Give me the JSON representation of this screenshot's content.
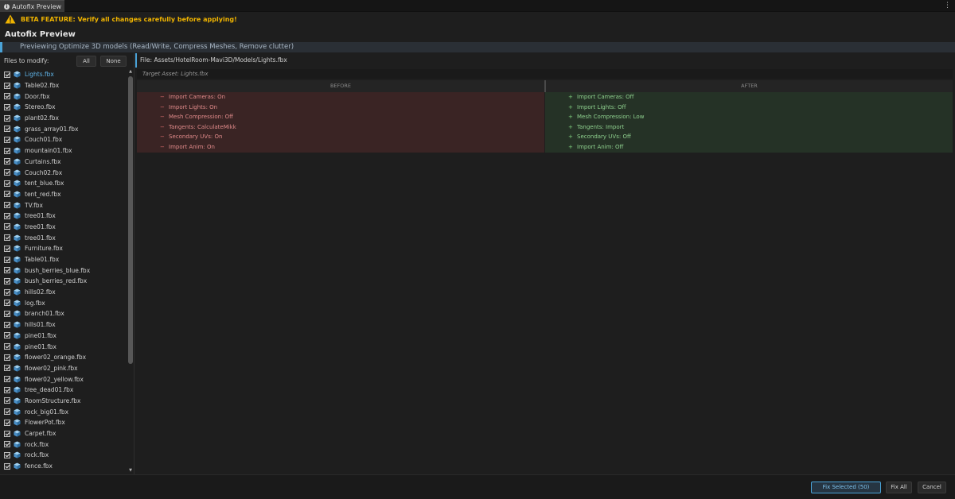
{
  "window": {
    "tab_label": "Autofix Preview",
    "menu_glyph": "⋮"
  },
  "warning": {
    "text": "BETA FEATURE: Verify all changes carefully before applying!"
  },
  "header": {
    "title": "Autofix Preview"
  },
  "preview_bar": {
    "text": "Previewing Optimize 3D models (Read/Write, Compress Meshes, Remove clutter)"
  },
  "files": {
    "heading": "Files to modify:",
    "all_label": "All",
    "none_label": "None",
    "items": [
      "Lights.fbx",
      "Table02.fbx",
      "Door.fbx",
      "Stereo.fbx",
      "plant02.fbx",
      "grass_array01.fbx",
      "Couch01.fbx",
      "mountain01.fbx",
      "Curtains.fbx",
      "Couch02.fbx",
      "tent_blue.fbx",
      "tent_red.fbx",
      "TV.fbx",
      "tree01.fbx",
      "tree01.fbx",
      "tree01.fbx",
      "Furniture.fbx",
      "Table01.fbx",
      "bush_berries_blue.fbx",
      "bush_berries_red.fbx",
      "hills02.fbx",
      "log.fbx",
      "branch01.fbx",
      "hills01.fbx",
      "pine01.fbx",
      "pine01.fbx",
      "flower02_orange.fbx",
      "flower02_pink.fbx",
      "flower02_yellow.fbx",
      "tree_dead01.fbx",
      "RoomStructure.fbx",
      "rock_big01.fbx",
      "FlowerPot.fbx",
      "Carpet.fbx",
      "rock.fbx",
      "rock.fbx",
      "fence.fbx"
    ],
    "selected_index": 0
  },
  "detail": {
    "file_path": "File: Assets/HotelRoom-Mavi3D/Models/Lights.fbx",
    "target_asset": "Target Asset: Lights.fbx",
    "before_label": "BEFORE",
    "after_label": "AFTER",
    "before": [
      "Import Cameras: On",
      "Import Lights: On",
      "Mesh Compression: Off",
      "Tangents: CalculateMikk",
      "Secondary UVs: On",
      "Import Anim: On"
    ],
    "after": [
      "Import Cameras: Off",
      "Import Lights: Off",
      "Mesh Compression: Low",
      "Tangents: Import",
      "Secondary UVs: Off",
      "Import Anim: Off"
    ],
    "minus_sign": "−",
    "plus_sign": "+"
  },
  "footer": {
    "fix_selected_label": "Fix Selected (50)",
    "fix_all_label": "Fix All",
    "cancel_label": "Cancel"
  },
  "colors": {
    "accent": "#4aa3d8",
    "warning": "#f0b400",
    "removed_bg": "#3a2424",
    "added_bg": "#253226"
  },
  "icons": {
    "tab": "info-icon",
    "warning": "warning-triangle-icon",
    "file": "cube-icon",
    "checkbox": "checkbox-checked-icon"
  }
}
